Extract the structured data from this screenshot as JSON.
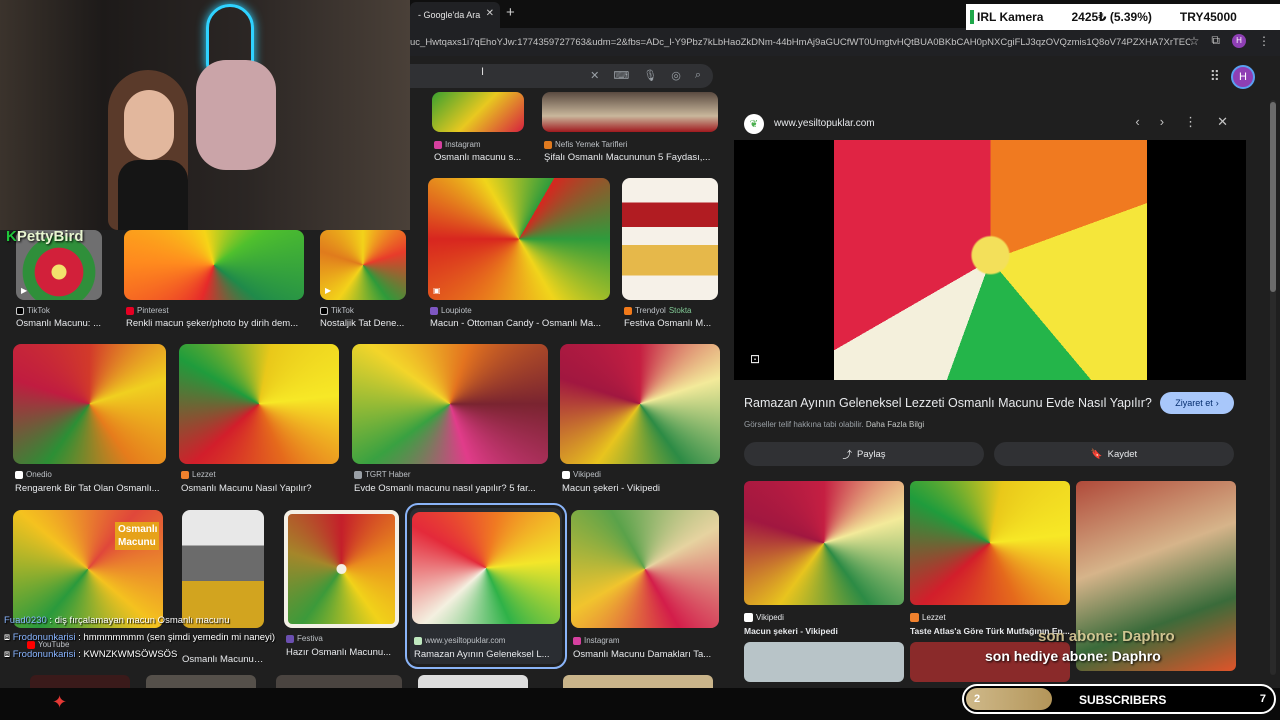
{
  "browser": {
    "tab_title": "- Google'da Ara",
    "url": "uc_Hwtqaxs1i7qEhoYJw:1774359727763&udm=2&fbs=ADc_l-Y9Pbz7kLbHaoZkDNm-44bHmAj9aGUCfWT0UmgtvHQtBUA0BKbCAH0pNXCgiFLJ3qzOVQzmis1Q8oV74PZXHA7XrTEC...",
    "profile_initial": "H"
  },
  "google": {
    "profile_initial": "H"
  },
  "grid": {
    "row0": [
      {
        "source": "Instagram",
        "title": "Osmanlı macunu s..."
      },
      {
        "source": "Nefis Yemek Tarifleri",
        "title": "Şifalı Osmanlı Macununun 5 Faydası,..."
      }
    ],
    "row1": [
      {
        "source": "TikTok",
        "title": "Osmanlı Macunu: ..."
      },
      {
        "source": "Pinterest",
        "title": "Renkli macun şeker/photo by dirih dem..."
      },
      {
        "source": "TikTok",
        "title": "Nostaljik Tat Dene..."
      },
      {
        "source": "Loupiote",
        "title": "Macun - Ottoman Candy - Osmanlı Ma..."
      },
      {
        "source": "Trendyol",
        "badge": "Stokta",
        "title": "Festiva Osmanlı M..."
      }
    ],
    "row2": [
      {
        "source": "Onedio",
        "title": "Rengarenk Bir Tat Olan Osmanlı..."
      },
      {
        "source": "Lezzet",
        "title": "Osmanlı Macunu Nasıl Yapılır?"
      },
      {
        "source": "TGRT Haber",
        "title": "Evde Osmanlı macunu nasıl yapılır? 5 far..."
      },
      {
        "source": "Vikipedi",
        "title": "Macun şekeri - Vikipedi"
      }
    ],
    "row3": [
      {
        "source": "YouTube",
        "title": "Osmanlı Macunu",
        "overlay_text": "Osmanlı Macunu"
      },
      {
        "source": "TikTok",
        "title": "Osmanlı Macunu ..."
      },
      {
        "source": "Festiva",
        "title": "Hazır Osmanlı Macunu..."
      },
      {
        "source": "www.yesiltopuklar.com",
        "title": "Ramazan Ayının Geleneksel L..."
      },
      {
        "source": "Instagram",
        "title": "Osmanlı Macunu Damakları Ta..."
      }
    ]
  },
  "panel": {
    "domain": "www.yesiltopuklar.com",
    "title": "Ramazan Ayının Geleneksel Lezzeti Osmanlı Macunu Evde Nasıl Yapılır?",
    "visit_label": "Ziyaret et",
    "note": "Görseller telif hakkına tabi olabilir.",
    "note_link": "Daha Fazla Bilgi",
    "share_label": "Paylaş",
    "save_label": "Kaydet",
    "related": [
      {
        "source": "Vikipedi",
        "title": "Macun şekeri - Vikipedi"
      },
      {
        "source": "Lezzet",
        "title": "Taste Atlas'a Göre Türk Mutfağının En..."
      },
      {
        "source": "",
        "title": ""
      }
    ]
  },
  "stream": {
    "streamer": "PettyBird",
    "ticker_name": "IRL Kamera",
    "ticker_value": "2425₺ (5.39%)",
    "ticker_goal": "TRY45000",
    "chat": [
      {
        "user": "Fuad0230",
        "msg": "diş fırçalamayan macun Osmanlı macunu"
      },
      {
        "user": "Frodonunkarisi",
        "msg": "hmmmmmmm (sen şimdi yemedin mi naneyi)"
      },
      {
        "user": "Frodonunkarisi",
        "msg": "KWNZKWMSÖWSÖS"
      }
    ],
    "sub_ghost": "son abone: Daphro",
    "sub_note": "son hediye abone: Daphro",
    "subs_current": "2",
    "subs_label": "SUBSCRIBERS",
    "subs_goal": "7",
    "subs_progress": 0.28
  }
}
